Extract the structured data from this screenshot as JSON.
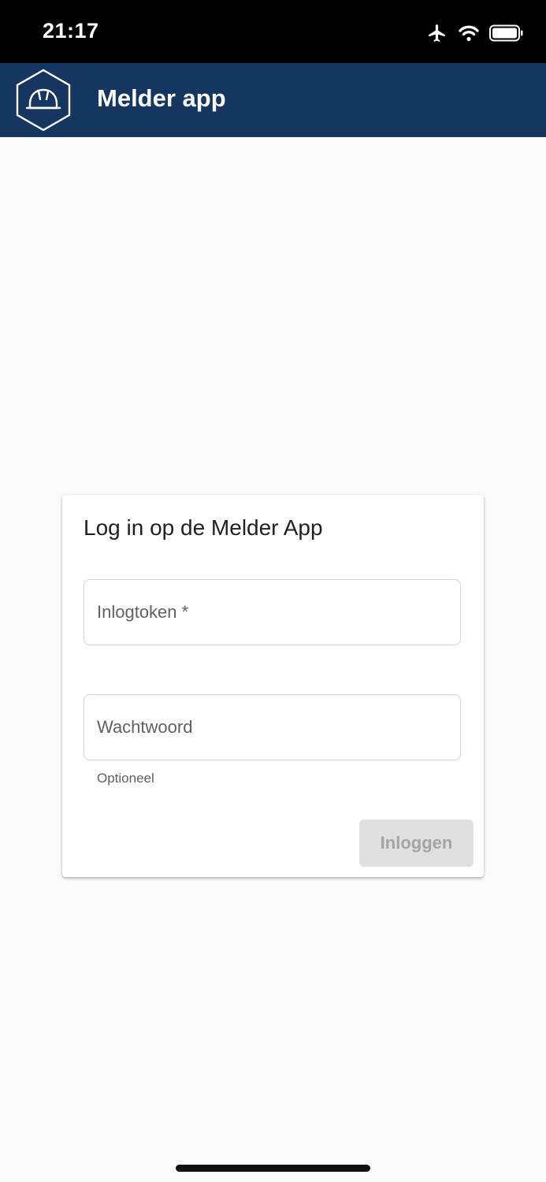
{
  "status_bar": {
    "time": "21:17",
    "icons": [
      "airplane-icon",
      "wifi-icon",
      "battery-icon"
    ]
  },
  "app_bar": {
    "title": "Melder app",
    "logo_icon": "hard-hat-hexagon-icon",
    "color": "#143661"
  },
  "login_card": {
    "title": "Log in op de Melder App",
    "token_field": {
      "placeholder": "Inlogtoken *",
      "value": ""
    },
    "password_field": {
      "placeholder": "Wachtwoord",
      "value": "",
      "helper": "Optioneel"
    },
    "submit_label": "Inloggen",
    "submit_state": "disabled"
  }
}
